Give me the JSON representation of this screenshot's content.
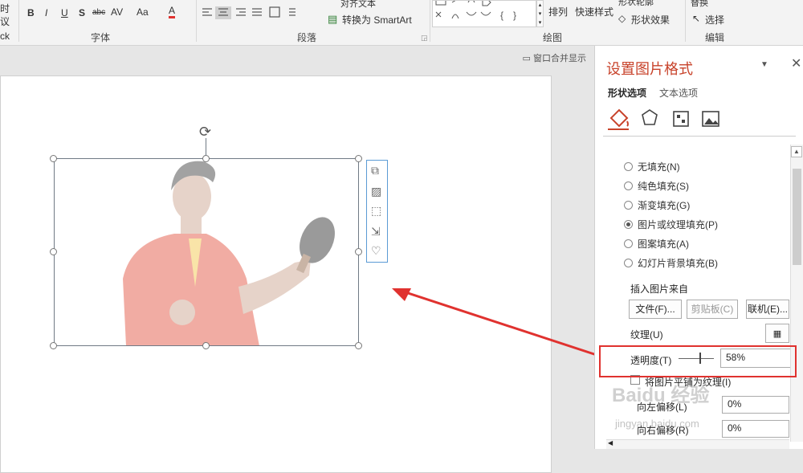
{
  "ribbon": {
    "font_group": "字体",
    "paragraph_group": "段落",
    "drawing_group": "绘图",
    "editing_group": "编辑",
    "bold": "B",
    "italic": "I",
    "underline": "U",
    "shadow": "S",
    "strike": "abc",
    "spacing": "AV",
    "case": "Aa",
    "font_color": "A",
    "align_text": "对齐文本",
    "convert_smartart": "转换为 SmartArt",
    "arrange": "排列",
    "quick_styles": "快速样式",
    "shape_outline": "形状轮廓",
    "shape_effects": "形状效果",
    "replace": "替换",
    "select": "选择",
    "left_clip_1": "时",
    "left_clip_2": "议",
    "left_clip_3": "ck"
  },
  "canvas": {
    "merge_window": "窗口合并显示"
  },
  "pane": {
    "title": "设置图片格式",
    "tabs": [
      "形状选项",
      "文本选项"
    ],
    "fill_options": [
      {
        "label": "无填充(N)",
        "selected": false
      },
      {
        "label": "纯色填充(S)",
        "selected": false
      },
      {
        "label": "渐变填充(G)",
        "selected": false
      },
      {
        "label": "图片或纹理填充(P)",
        "selected": true
      },
      {
        "label": "图案填充(A)",
        "selected": false
      },
      {
        "label": "幻灯片背景填充(B)",
        "selected": false
      }
    ],
    "insert_from": "插入图片来自",
    "file_btn": "文件(F)...",
    "clipboard_btn": "剪贴板(C)",
    "online_btn": "联机(E)...",
    "texture": "纹理(U)",
    "transparency_label": "透明度(T)",
    "transparency_value": "58%",
    "tile_label": "将图片平铺为纹理(I)",
    "offset_left": "向左偏移(L)",
    "offset_left_value": "0%",
    "offset_right": "向右偏移(R)",
    "offset_right_value": "0%"
  },
  "watermark": {
    "brand": "Baidu 经验",
    "url": "jingyan.baidu.com"
  },
  "colors": {
    "accent": "#c8432b",
    "highlight_box": "#e0322f",
    "qa_border": "#5b9bd5"
  }
}
